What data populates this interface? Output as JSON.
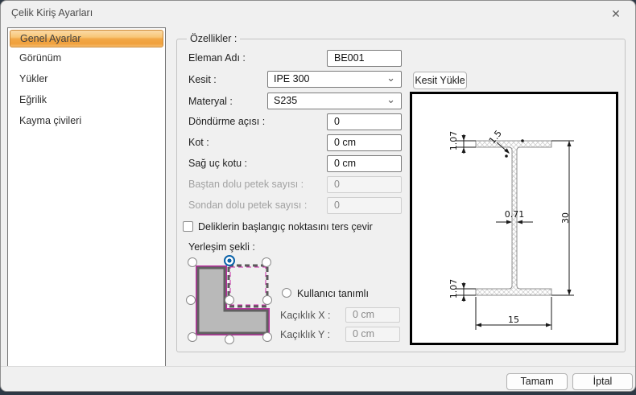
{
  "window": {
    "title": "Çelik Kiriş Ayarları"
  },
  "icons": {
    "close": "✕",
    "combo_chevron": "⌄"
  },
  "sidebar": {
    "items": [
      {
        "label": "Genel Ayarlar",
        "selected": true
      },
      {
        "label": "Görünüm",
        "selected": false
      },
      {
        "label": "Yükler",
        "selected": false
      },
      {
        "label": "Eğrilik",
        "selected": false
      },
      {
        "label": "Kayma çivileri",
        "selected": false
      }
    ]
  },
  "properties": {
    "group_title": "Özellikler :",
    "eleman_adi": {
      "label": "Eleman Adı :",
      "value": "BE001"
    },
    "kesit": {
      "label": "Kesit :",
      "value": "IPE 300"
    },
    "kesit_yukle_button": "Kesit Yükle",
    "materyal": {
      "label": "Materyal :",
      "value": "S235"
    },
    "dondurme_acisi": {
      "label": "Döndürme açısı :",
      "value": "0"
    },
    "kot": {
      "label": "Kot :",
      "value": "0 cm"
    },
    "sag_uc_kotu": {
      "label": "Sağ uç kotu :",
      "value": "0 cm"
    },
    "bastan_dolu": {
      "label": "Baştan dolu petek sayısı :",
      "value": "0",
      "disabled": true
    },
    "sondan_dolu": {
      "label": "Sondan dolu petek sayısı :",
      "value": "0",
      "disabled": true
    },
    "ters_cevir_checkbox": {
      "label": "Deliklerin başlangıç noktasını ters çevir",
      "checked": false
    },
    "yerlesim_sekli_label": "Yerleşim şekli :",
    "placement_selected": "top-middle",
    "kullanici_tanimli": {
      "label": "Kullanıcı tanımlı",
      "checked": false
    },
    "kacilik_x": {
      "label": "Kaçıklık X :",
      "value": "0 cm",
      "disabled": true
    },
    "kacilik_y": {
      "label": "Kaçıklık Y :",
      "value": "0 cm",
      "disabled": true
    }
  },
  "section_preview": {
    "dims": {
      "height": "30",
      "width": "15",
      "web_thickness": "0.71",
      "top_flange_thickness": "1.07",
      "bottom_flange_thickness": "1.07",
      "root_radius": "1.5"
    }
  },
  "footer": {
    "ok_button": "Tamam",
    "cancel_button": "İptal"
  },
  "colors": {
    "dialog_bg": "#f0f0f0",
    "sidebar_selected_orange": "#f2a847",
    "selected_radio_blue": "#0a62a9",
    "diagram_magenta": "#bf2fa4",
    "preview_border": "#000000"
  }
}
